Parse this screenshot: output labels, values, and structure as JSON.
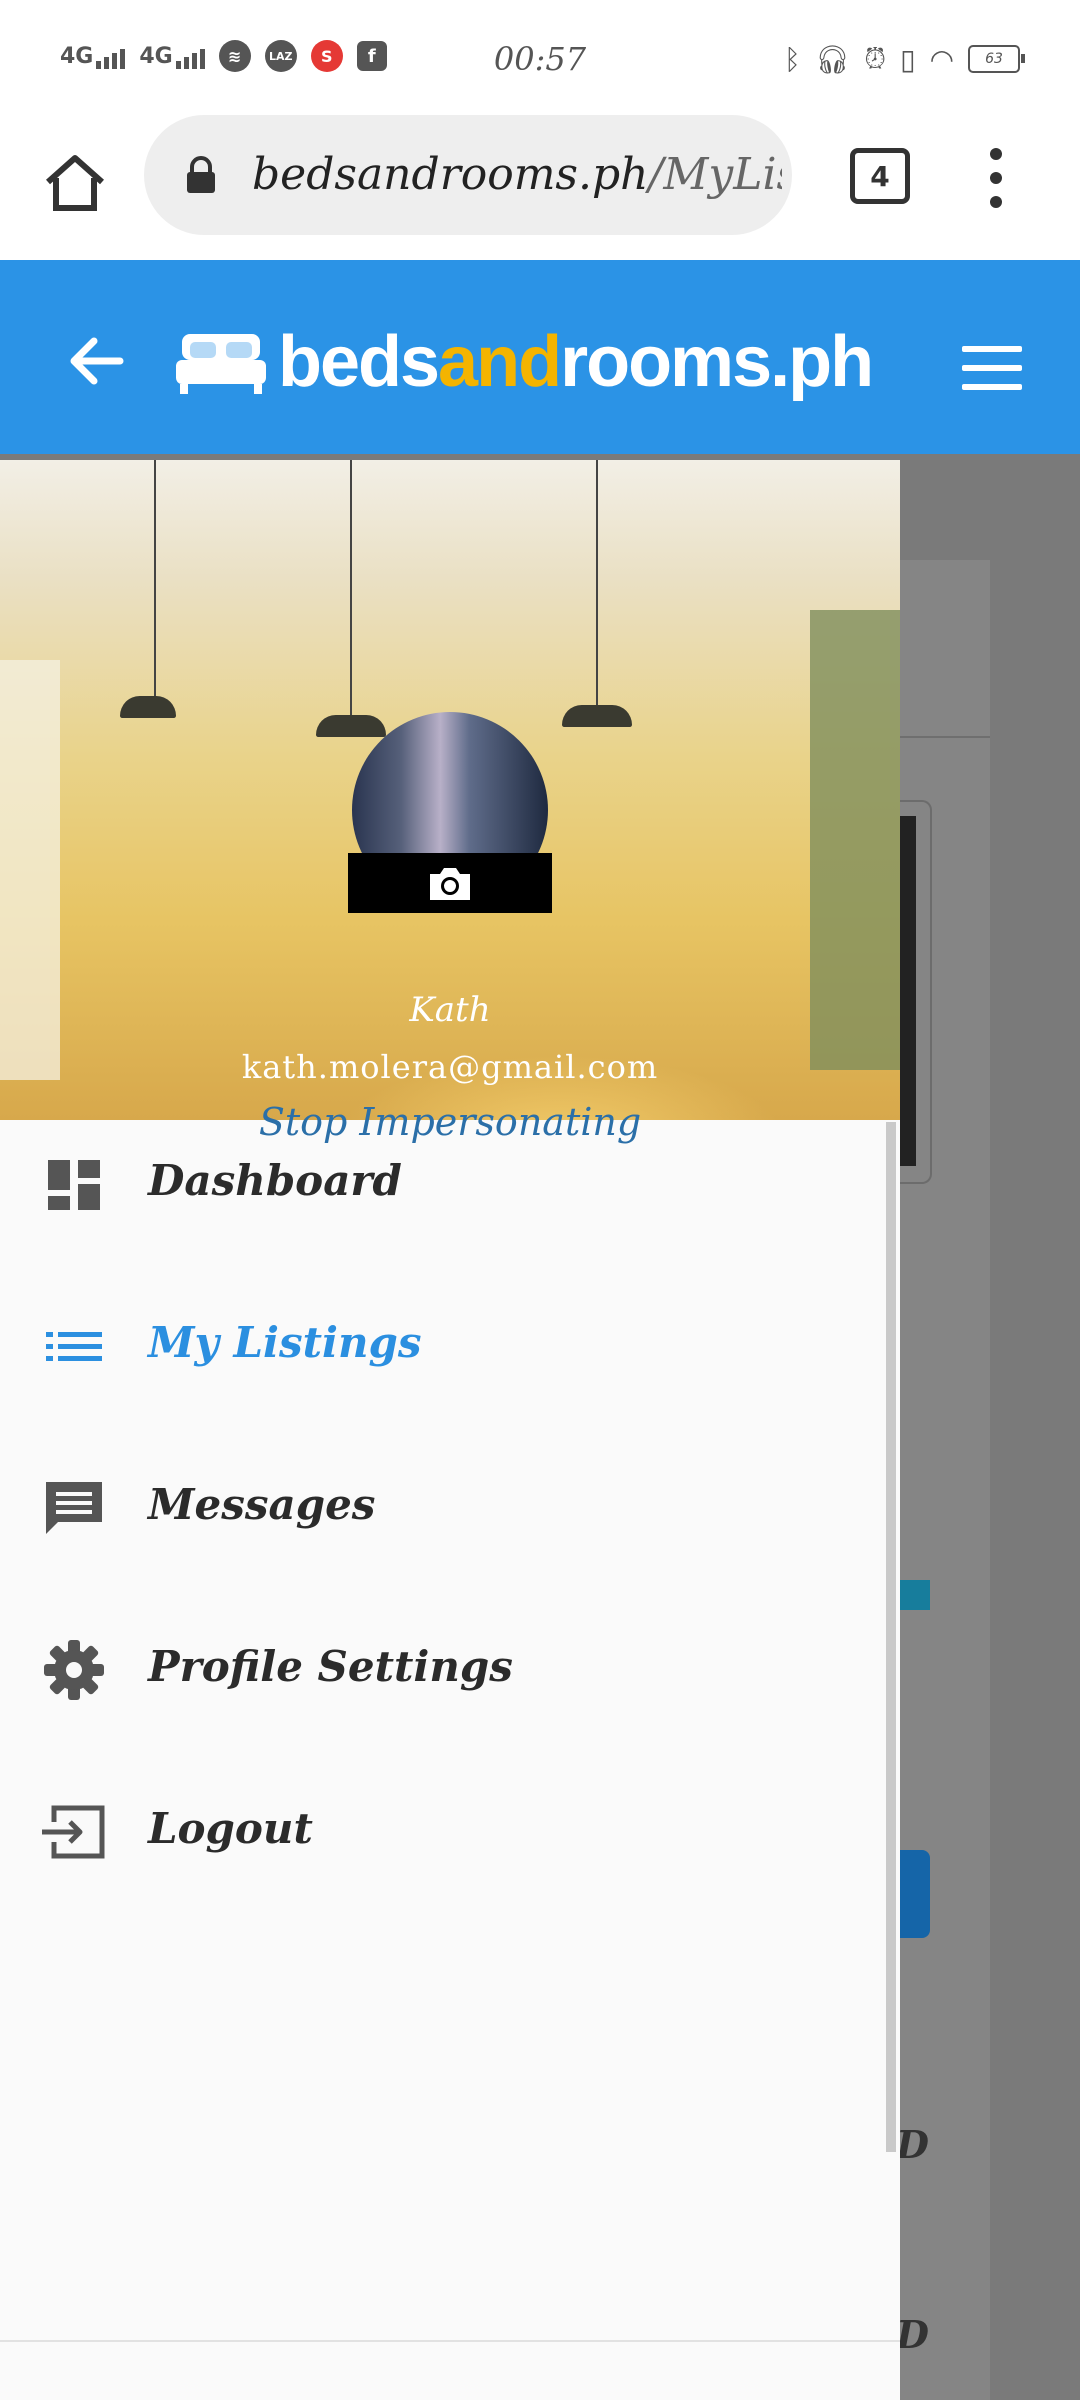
{
  "status_bar": {
    "signal_1": "4G",
    "signal_2": "4G",
    "lazada_badge": "LAZ",
    "shopee_badge": "S",
    "facebook_badge": "f",
    "time": "00:57",
    "battery": "63"
  },
  "browser": {
    "url_domain": "bedsandrooms.ph",
    "url_path": "/MyLis",
    "tab_count": "4"
  },
  "site_header": {
    "logo_part_1": "beds",
    "logo_part_2": "and",
    "logo_part_3": "rooms.ph",
    "brand_color": "#2b93e6",
    "accent_color": "#f4b400"
  },
  "profile": {
    "name": "Kath",
    "email": "kath.molera@gmail.com",
    "stop_impersonating": "Stop Impersonating"
  },
  "menu": {
    "items": [
      {
        "label": "Dashboard",
        "icon": "dashboard-icon",
        "active": false
      },
      {
        "label": "My Listings",
        "icon": "list-icon",
        "active": true
      },
      {
        "label": "Messages",
        "icon": "message-icon",
        "active": false
      },
      {
        "label": "Profile Settings",
        "icon": "gear-icon",
        "active": false
      },
      {
        "label": "Logout",
        "icon": "logout-icon",
        "active": false
      }
    ],
    "active_color": "#2b8fe0"
  },
  "background_page": {
    "text_1": "D",
    "text_2": "D"
  }
}
